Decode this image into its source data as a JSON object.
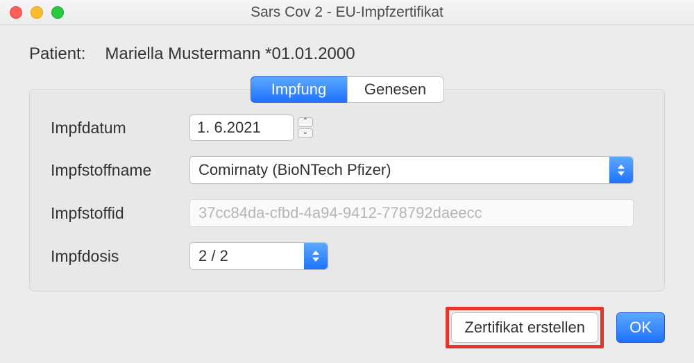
{
  "window": {
    "title": "Sars Cov 2 - EU-Impfzertifikat"
  },
  "patient": {
    "label": "Patient:",
    "name": "Mariella Mustermann *01.01.2000"
  },
  "tabs": {
    "impfung": "Impfung",
    "genesen": "Genesen"
  },
  "form": {
    "impfdatum_label": "Impfdatum",
    "impfdatum_value": "1.  6.2021",
    "impfstoffname_label": "Impfstoffname",
    "impfstoffname_value": "Comirnaty (BioNTech Pfizer)",
    "impfstoffid_label": "Impfstoffid",
    "impfstoffid_value": "37cc84da-cfbd-4a94-9412-778792daeecc",
    "impfdosis_label": "Impfdosis",
    "impfdosis_value": "2 / 2"
  },
  "buttons": {
    "create": "Zertifikat erstellen",
    "ok": "OK"
  }
}
